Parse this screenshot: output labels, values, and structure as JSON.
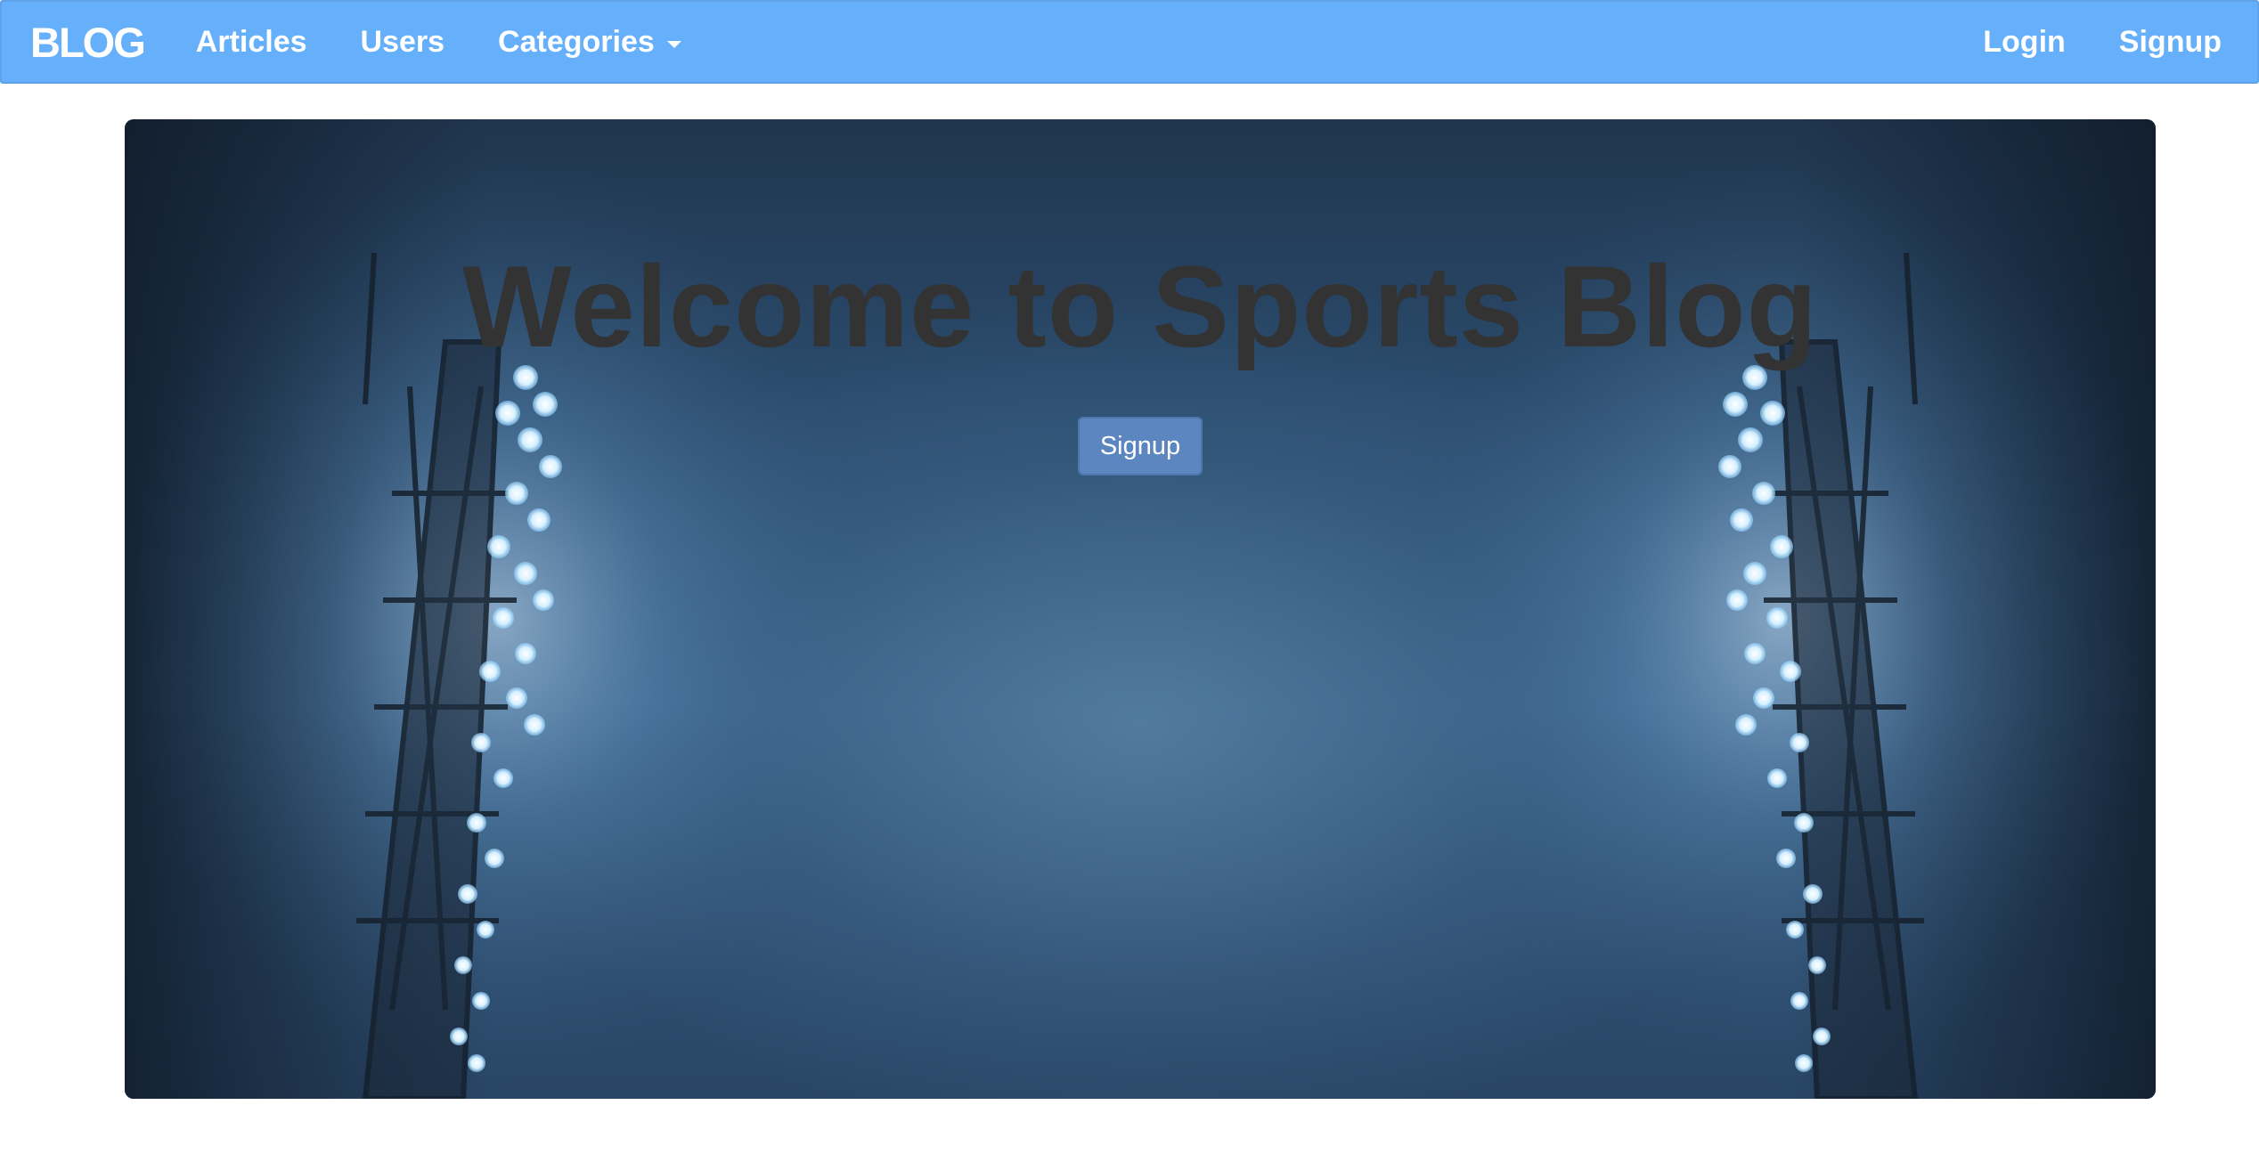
{
  "navbar": {
    "brand": "BLOG",
    "links": {
      "articles": "Articles",
      "users": "Users",
      "categories": "Categories"
    },
    "right": {
      "login": "Login",
      "signup": "Signup"
    }
  },
  "hero": {
    "title": "Welcome to Sports Blog",
    "button_label": "Signup",
    "background": "stadium-floodlights-image"
  },
  "colors": {
    "navbar": "#66b0fb",
    "title_text": "#333333",
    "button": "#5b86bf"
  }
}
